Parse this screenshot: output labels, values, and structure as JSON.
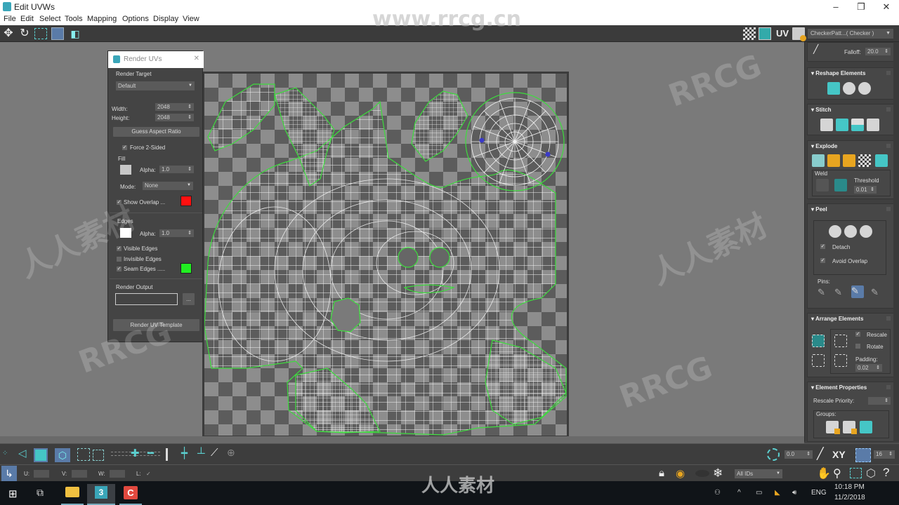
{
  "window": {
    "title": "Edit UVWs",
    "minimize": "–",
    "maximize": "❐",
    "close": "✕"
  },
  "menu": [
    "File",
    "Edit",
    "Select",
    "Tools",
    "Mapping",
    "Options",
    "Display",
    "View"
  ],
  "top_toolbar": {
    "left_icons": [
      "move-icon",
      "rotate-icon",
      "scale-icon",
      "freeform-icon",
      "mirror-icon"
    ],
    "right_icons": [
      "checker-display-icon",
      "show-map-icon",
      "uv-label",
      "texture-options-icon"
    ],
    "uv_label": "UV",
    "texture_dropdown": "CheckerPatt...( Checker )"
  },
  "render_dialog": {
    "title": "Render UVs",
    "render_target_label": "Render Target",
    "render_target_value": "Default",
    "width_label": "Width:",
    "width_value": "2048",
    "height_label": "Height:",
    "height_value": "2048",
    "guess_aspect_button": "Guess Aspect Ratio",
    "force_2sided_label": "Force 2-Sided",
    "force_2sided_checked": true,
    "fill_label": "Fill",
    "fill_color": "#c8c8c8",
    "fill_alpha_label": "Alpha:",
    "fill_alpha_value": "1.0",
    "mode_label": "Mode:",
    "mode_value": "None",
    "show_overlap_label": "Show Overlap ...",
    "show_overlap_checked": true,
    "overlap_color": "#ff1010",
    "edges_label": "Edges",
    "edges_color": "#ffffff",
    "edges_alpha_label": "Alpha:",
    "edges_alpha_value": "1.0",
    "visible_edges_label": "Visible Edges",
    "visible_edges_checked": true,
    "invisible_edges_label": "Invisible Edges",
    "invisible_edges_checked": false,
    "seam_edges_label": "Seam Edges .....",
    "seam_edges_checked": true,
    "seam_color": "#22ee22",
    "render_output_label": "Render Output",
    "render_output_value": "",
    "browse_button": "...",
    "render_template_button": "Render UV Template"
  },
  "right_panel": {
    "falloff_label": "Falloff:",
    "falloff_value": "20.0",
    "reshape_title": "Reshape Elements",
    "stitch_title": "Stitch",
    "explode_title": "Explode",
    "weld_label": "Weld",
    "threshold_label": "Threshold",
    "threshold_value": "0.01",
    "peel_title": "Peel",
    "detach_label": "Detach",
    "detach_checked": true,
    "avoid_overlap_label": "Avoid Overlap",
    "avoid_overlap_checked": true,
    "pins_label": "Pins:",
    "arrange_title": "Arrange Elements",
    "rescale_label": "Rescale",
    "rescale_checked": true,
    "rotate_label": "Rotate",
    "rotate_checked": false,
    "padding_label": "Padding:",
    "padding_value": "0.02",
    "element_props_title": "Element Properties",
    "rescale_priority_label": "Rescale Priority:",
    "rescale_priority_value": "",
    "groups_label": "Groups:"
  },
  "bottom_toolbar": {
    "u_label": "U:",
    "v_label": "V:",
    "w_label": "W:",
    "l_label": "L:",
    "u_value": "",
    "v_value": "",
    "w_value": "",
    "soft_sel_value": "0.0",
    "xy_label": "XY",
    "grid_value": "16",
    "ids_dropdown": "All IDs"
  },
  "taskbar": {
    "lang": "ENG",
    "time": "10:18 PM",
    "date": "11/2/2018",
    "apps": [
      "windows-start",
      "task-view",
      "file-explorer",
      "3ds-max",
      "camtasia"
    ]
  },
  "watermarks": [
    "www.rrcg.cn",
    "RRCG",
    "人人素材"
  ],
  "colors": {
    "accent_teal": "#45c6c6",
    "seam_green": "#33dd33",
    "pin_blue": "#3a3ac8"
  }
}
